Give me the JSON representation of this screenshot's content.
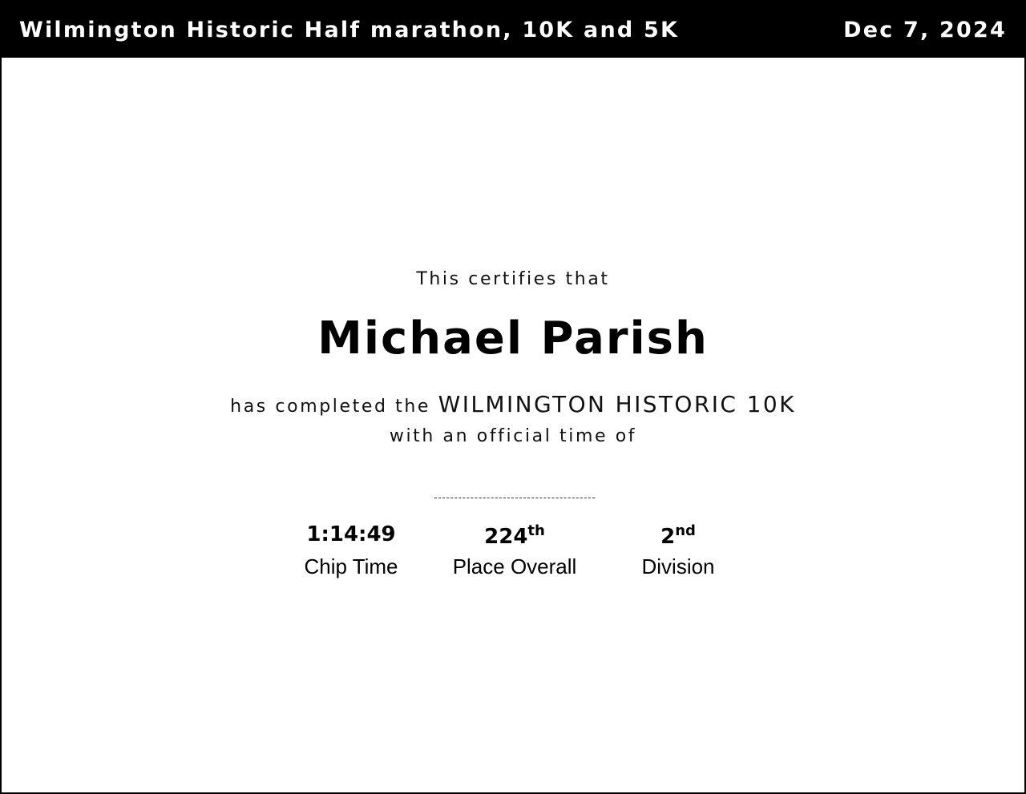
{
  "header": {
    "event_title": "Wilmington Historic Half marathon, 10K and 5K",
    "date": "Dec 7, 2024"
  },
  "certificate": {
    "intro": "This certifies that",
    "runner_name": "Michael Parish",
    "completed_prefix": "has completed the",
    "race_name": "WILMINGTON HISTORIC 10K",
    "official_time_text": "with an official time of"
  },
  "stats": {
    "chip_time": {
      "value": "1:14:49",
      "label": "Chip Time"
    },
    "place_overall": {
      "number": "224",
      "suffix": "th",
      "label": "Place Overall"
    },
    "division": {
      "number": "2",
      "suffix": "nd",
      "label": "Division"
    }
  },
  "colors": {
    "header_bg": "#000000",
    "header_text": "#ffffff",
    "body_bg": "#ffffff",
    "text": "#000000"
  }
}
